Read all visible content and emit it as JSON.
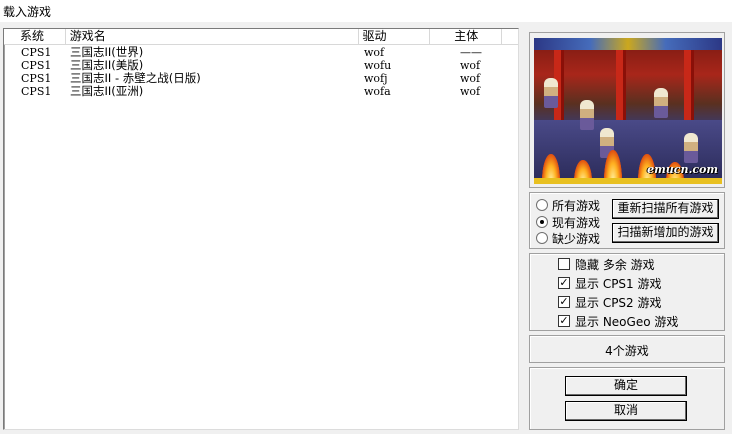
{
  "window": {
    "title": "载入游戏"
  },
  "list": {
    "columns": [
      "系统",
      "游戏名",
      "驱动",
      "主体"
    ],
    "rows": [
      {
        "system": "CPS1",
        "name": "三国志II(世界)",
        "driver": "wof",
        "parent": "——"
      },
      {
        "system": "CPS1",
        "name": "三国志II(美版)",
        "driver": "wofu",
        "parent": "wof"
      },
      {
        "system": "CPS1",
        "name": "三国志II - 赤壁之战(日版)",
        "driver": "wofj",
        "parent": "wof"
      },
      {
        "system": "CPS1",
        "name": "三国志II(亚洲)",
        "driver": "wofa",
        "parent": "wof"
      }
    ]
  },
  "preview": {
    "watermark": "emucn.com"
  },
  "filter": {
    "options": [
      "所有游戏",
      "现有游戏",
      "缺少游戏"
    ],
    "selected_index": 1,
    "rescan_all_label": "重新扫描所有游戏",
    "scan_new_label": "扫描新增加的游戏"
  },
  "show": {
    "options": [
      {
        "label": "隐藏 多余 游戏",
        "checked": false
      },
      {
        "label": "显示 CPS1 游戏",
        "checked": true
      },
      {
        "label": "显示 CPS2 游戏",
        "checked": true
      },
      {
        "label": "显示 NeoGeo 游戏",
        "checked": true
      }
    ]
  },
  "count_label": "4个游戏",
  "buttons": {
    "ok": "确定",
    "cancel": "取消"
  }
}
